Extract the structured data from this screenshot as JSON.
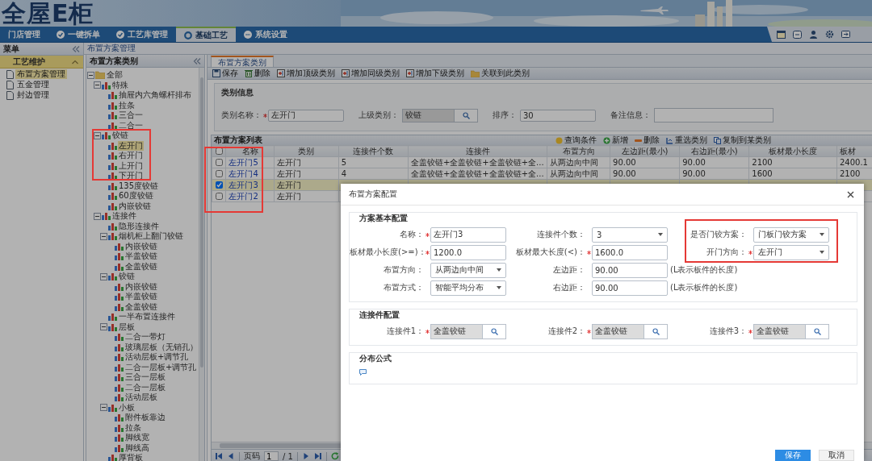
{
  "banner": {
    "logo": "全屋E柜"
  },
  "nav": {
    "tabs": [
      {
        "label": "门店管理",
        "selected": false,
        "kind": "plain"
      },
      {
        "label": "一键拆单",
        "selected": false,
        "kind": "check"
      },
      {
        "label": "工艺库管理",
        "selected": false,
        "kind": "check"
      },
      {
        "label": "基础工艺",
        "selected": true,
        "kind": "ring"
      },
      {
        "label": "系统设置",
        "selected": false,
        "kind": "dots"
      }
    ]
  },
  "menu": {
    "title": "菜单",
    "group": "工艺维护",
    "items": [
      {
        "label": "布置方案管理",
        "selected": true
      },
      {
        "label": "五金管理",
        "selected": false
      },
      {
        "label": "封边管理",
        "selected": false
      }
    ]
  },
  "breadcrumb": "布置方案管理",
  "tree": {
    "title": "布置方案类别",
    "nodes": [
      {
        "label": "全部",
        "kind": "folder",
        "selected": false,
        "expanded": true,
        "children": [
          {
            "label": "特殊",
            "selected": false,
            "expanded": true,
            "children": [
              {
                "label": "抽屉内六角螺杆排布",
                "selected": false
              },
              {
                "label": "拉条",
                "selected": false
              },
              {
                "label": "三合一",
                "selected": false
              },
              {
                "label": "二合一",
                "selected": false
              }
            ]
          },
          {
            "label": "铰链",
            "selected": false,
            "expanded": true,
            "children": [
              {
                "label": "左开门",
                "selected": true
              },
              {
                "label": "右开门",
                "selected": false
              },
              {
                "label": "上开门",
                "selected": false
              },
              {
                "label": "下开门",
                "selected": false
              },
              {
                "label": "135度铰链",
                "selected": false
              },
              {
                "label": "60度铰链",
                "selected": false
              },
              {
                "label": "内嵌铰链",
                "selected": false
              }
            ]
          },
          {
            "label": "连接件",
            "selected": false,
            "expanded": true,
            "children": [
              {
                "label": "隐形连接件",
                "selected": false
              },
              {
                "label": "烟机柜上翻门铰链",
                "selected": false,
                "expanded": true,
                "children": [
                  {
                    "label": "内嵌铰链",
                    "selected": false
                  },
                  {
                    "label": "半盖铰链",
                    "selected": false
                  },
                  {
                    "label": "全盖铰链",
                    "selected": false
                  }
                ]
              },
              {
                "label": "铰链",
                "selected": false,
                "expanded": true,
                "children": [
                  {
                    "label": "内嵌铰链",
                    "selected": false
                  },
                  {
                    "label": "半盖铰链",
                    "selected": false
                  },
                  {
                    "label": "全盖铰链",
                    "selected": false
                  }
                ]
              },
              {
                "label": "一半布置连接件",
                "selected": false
              },
              {
                "label": "层板",
                "selected": false,
                "expanded": true,
                "children": [
                  {
                    "label": "二合一带灯",
                    "selected": false
                  },
                  {
                    "label": "玻璃层板（无销孔）",
                    "selected": false
                  },
                  {
                    "label": "活动层板+调节孔",
                    "selected": false
                  },
                  {
                    "label": "二合一层板+调节孔",
                    "selected": false
                  },
                  {
                    "label": "三合一层板",
                    "selected": false
                  },
                  {
                    "label": "二合一层板",
                    "selected": false
                  },
                  {
                    "label": "活动层板",
                    "selected": false
                  }
                ]
              },
              {
                "label": "小板",
                "selected": false,
                "expanded": true,
                "children": [
                  {
                    "label": "附件板靠边",
                    "selected": false
                  },
                  {
                    "label": "拉条",
                    "selected": false
                  },
                  {
                    "label": "脚线宽",
                    "selected": false
                  },
                  {
                    "label": "脚线高",
                    "selected": false
                  }
                ]
              },
              {
                "label": "厚背板",
                "selected": false
              }
            ]
          }
        ]
      }
    ]
  },
  "main": {
    "tabs": [
      {
        "label": "布置方案类别",
        "selected": true
      }
    ],
    "toolbar": [
      {
        "label": "保存",
        "kind": "save"
      },
      {
        "label": "删除",
        "kind": "delete"
      },
      {
        "label": "增加顶级类别",
        "kind": "add"
      },
      {
        "label": "增加同级类别",
        "kind": "add"
      },
      {
        "label": "增加下级类别",
        "kind": "add"
      },
      {
        "label": "关联到此类别",
        "kind": "link"
      }
    ],
    "category": {
      "title": "类别信息",
      "fields": [
        {
          "label": "类别名称：",
          "required": true,
          "value": "左开门",
          "kind": "text"
        },
        {
          "label": "上级类别：",
          "required": false,
          "value": "铰链",
          "kind": "lookup"
        },
        {
          "label": "排序：",
          "required": false,
          "value": "30",
          "kind": "text"
        },
        {
          "label": "备注信息：",
          "required": false,
          "kind": "textarea"
        }
      ]
    },
    "list": {
      "title": "布置方案列表",
      "actions": [
        {
          "label": "查询条件",
          "kind": "query"
        },
        {
          "label": "新增",
          "kind": "add"
        },
        {
          "label": "删除",
          "kind": "remove"
        },
        {
          "label": "重选类别",
          "kind": "move"
        },
        {
          "label": "复制到某类别",
          "kind": "copy"
        }
      ],
      "header_checked": false,
      "columns": [
        "名称",
        "类别",
        "连接件个数",
        "连接件",
        "布置方向",
        "左边距(最小)",
        "右边距(最小)",
        "板材最小长度",
        "板材"
      ],
      "rows": [
        {
          "checked": false,
          "selected": false,
          "cells": [
            "左开门5",
            "左开门",
            "5",
            "全盖铰链+全盖铰链+全盖铰链+全...",
            "从两边向中间",
            "90.00",
            "90.00",
            "2100",
            "2400.1"
          ]
        },
        {
          "checked": false,
          "selected": false,
          "cells": [
            "左开门4",
            "左开门",
            "4",
            "全盖铰链+全盖铰链+全盖铰链+全...",
            "从两边向中间",
            "90.00",
            "90.00",
            "1600",
            "2100"
          ]
        },
        {
          "checked": true,
          "selected": true,
          "cells": [
            "左开门3",
            "左开门"
          ]
        },
        {
          "checked": false,
          "selected": false,
          "cells": [
            "左开门2",
            "左开门"
          ]
        }
      ]
    },
    "pager": {
      "label": "页码",
      "page": "1",
      "total": "/ 1"
    }
  },
  "dialog": {
    "title": "布置方案配置",
    "sections": [
      {
        "title": "方案基本配置",
        "kind": "fields",
        "rows": [
          [
            {
              "label": "名称：",
              "required": true,
              "value": "左开门3",
              "kind": "text"
            },
            {
              "label": "连接件个数：",
              "required": false,
              "value": "3",
              "kind": "select"
            },
            {
              "label": "是否门铰方案：",
              "required": false,
              "value": "门板门铰方案",
              "kind": "select"
            }
          ],
          [
            {
              "label": "板材最小长度(>=)：",
              "required": true,
              "value": "1200.0",
              "kind": "text"
            },
            {
              "label": "板材最大长度(<)：",
              "required": true,
              "value": "1600.0",
              "kind": "text"
            },
            {
              "label": "开门方向：",
              "required": true,
              "value": "左开门",
              "kind": "select"
            }
          ],
          [
            {
              "label": "布置方向：",
              "required": false,
              "value": "从两边向中间",
              "kind": "select"
            },
            {
              "label": "左边距：",
              "required": false,
              "value": "90.00",
              "kind": "text",
              "hint": "(L表示板件的长度)"
            }
          ],
          [
            {
              "label": "布置方式：",
              "required": false,
              "value": "智能平均分布",
              "kind": "select"
            },
            {
              "label": "右边距：",
              "required": false,
              "value": "90.00",
              "kind": "text",
              "hint": "(L表示板件的长度)"
            }
          ]
        ]
      },
      {
        "title": "连接件配置",
        "kind": "fields",
        "rows": [
          [
            {
              "label": "连接件1：",
              "required": true,
              "value": "全盖铰链",
              "kind": "lookup"
            },
            {
              "label": "连接件2：",
              "required": true,
              "value": "全盖铰链",
              "kind": "lookup"
            },
            {
              "label": "连接件3：",
              "required": true,
              "value": "全盖铰链",
              "kind": "lookup"
            }
          ]
        ]
      },
      {
        "title": "分布公式",
        "kind": "formula"
      }
    ],
    "buttons": [
      {
        "label": "保存",
        "kind": "primary"
      },
      {
        "label": "取消",
        "kind": "default"
      }
    ]
  }
}
